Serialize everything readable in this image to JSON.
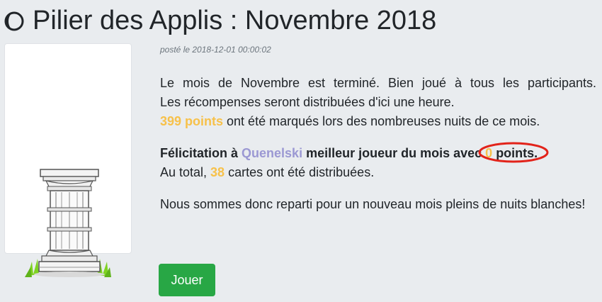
{
  "title": "Pilier des Applis : Novembre 2018",
  "title_icon": "half-moon-icon",
  "post_prefix": "posté le",
  "post_date": "2018-12-01 00:00:02",
  "paragraph1": {
    "line1": "Le mois de Novembre est terminé. Bien joué à tous les participants.",
    "line2": "Les récompenses seront distribuées d'ici une heure.",
    "points_value": "399 points",
    "line3_rest": " ont été marqués lors des nombreuses nuits de ce mois."
  },
  "paragraph2": {
    "congrats": "Félicitation à ",
    "player": "Quenelski",
    "best": " meilleur joueur du mois avec ",
    "player_points": "0",
    "points_word": " points.",
    "total_prefix": "Au total, ",
    "cards_count": "38",
    "total_suffix": " cartes ont été distribuées."
  },
  "paragraph3": "Nous sommes donc reparti pour un nouveau mois pleins de nuits blanches!",
  "play_button": "Jouer",
  "colors": {
    "background": "#e9ecef",
    "gold": "#f7c14a",
    "player": "#9b98d3",
    "button": "#28a745",
    "annotation": "#e2231a"
  }
}
